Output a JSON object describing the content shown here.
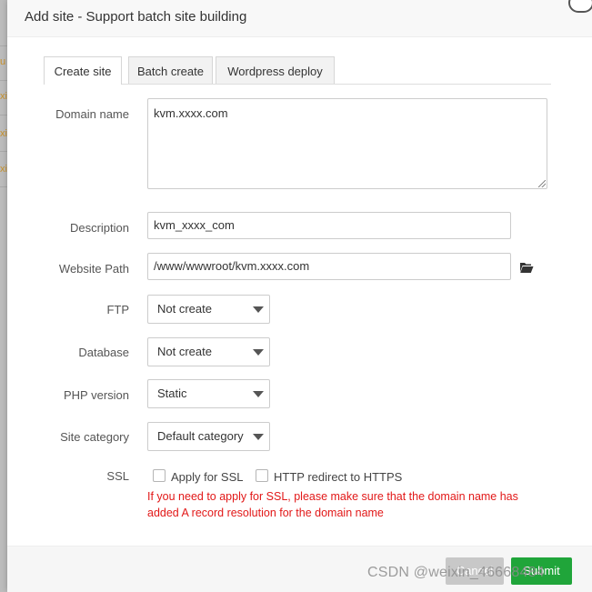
{
  "background": {
    "fragments": [
      "u",
      "xi",
      "xi",
      "xi"
    ]
  },
  "modal": {
    "title": "Add site - Support batch site building"
  },
  "tabs": [
    {
      "label": "Create site",
      "active": true
    },
    {
      "label": "Batch create",
      "active": false
    },
    {
      "label": "Wordpress deploy",
      "active": false
    }
  ],
  "form": {
    "domain_name": {
      "label": "Domain name",
      "value": "kvm.xxxx.com"
    },
    "description": {
      "label": "Description",
      "value": "kvm_xxxx_com"
    },
    "website_path": {
      "label": "Website Path",
      "value": "/www/wwwroot/kvm.xxxx.com"
    },
    "ftp": {
      "label": "FTP",
      "value": "Not create"
    },
    "database": {
      "label": "Database",
      "value": "Not create"
    },
    "php_version": {
      "label": "PHP version",
      "value": "Static"
    },
    "site_category": {
      "label": "Site category",
      "value": "Default category"
    },
    "ssl": {
      "label": "SSL",
      "apply_label": "Apply for SSL",
      "apply_checked": false,
      "redirect_label": "HTTP redirect to HTTPS",
      "redirect_checked": false,
      "note": "If you need to apply for SSL, please make sure that the domain name has added A record resolution for the domain name"
    }
  },
  "footer": {
    "cancel_label": "Cancel",
    "submit_label": "Submit"
  },
  "watermark": "CSDN @weixin_46668484",
  "colors": {
    "accent_green": "#20a53a",
    "cancel_gray": "#c8c8c8",
    "warning_red": "#e21818"
  }
}
